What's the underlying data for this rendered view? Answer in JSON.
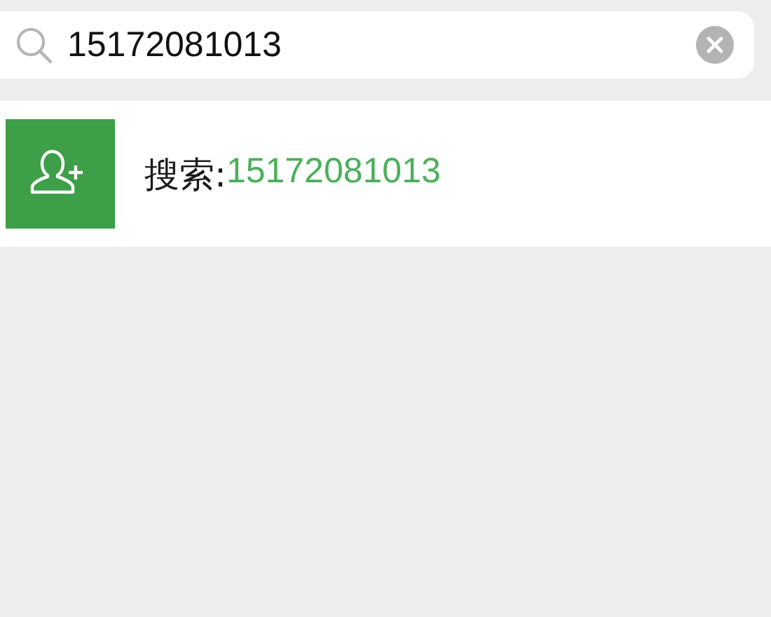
{
  "search": {
    "value": "15172081013"
  },
  "result": {
    "label": "搜索:",
    "query": "15172081013"
  }
}
